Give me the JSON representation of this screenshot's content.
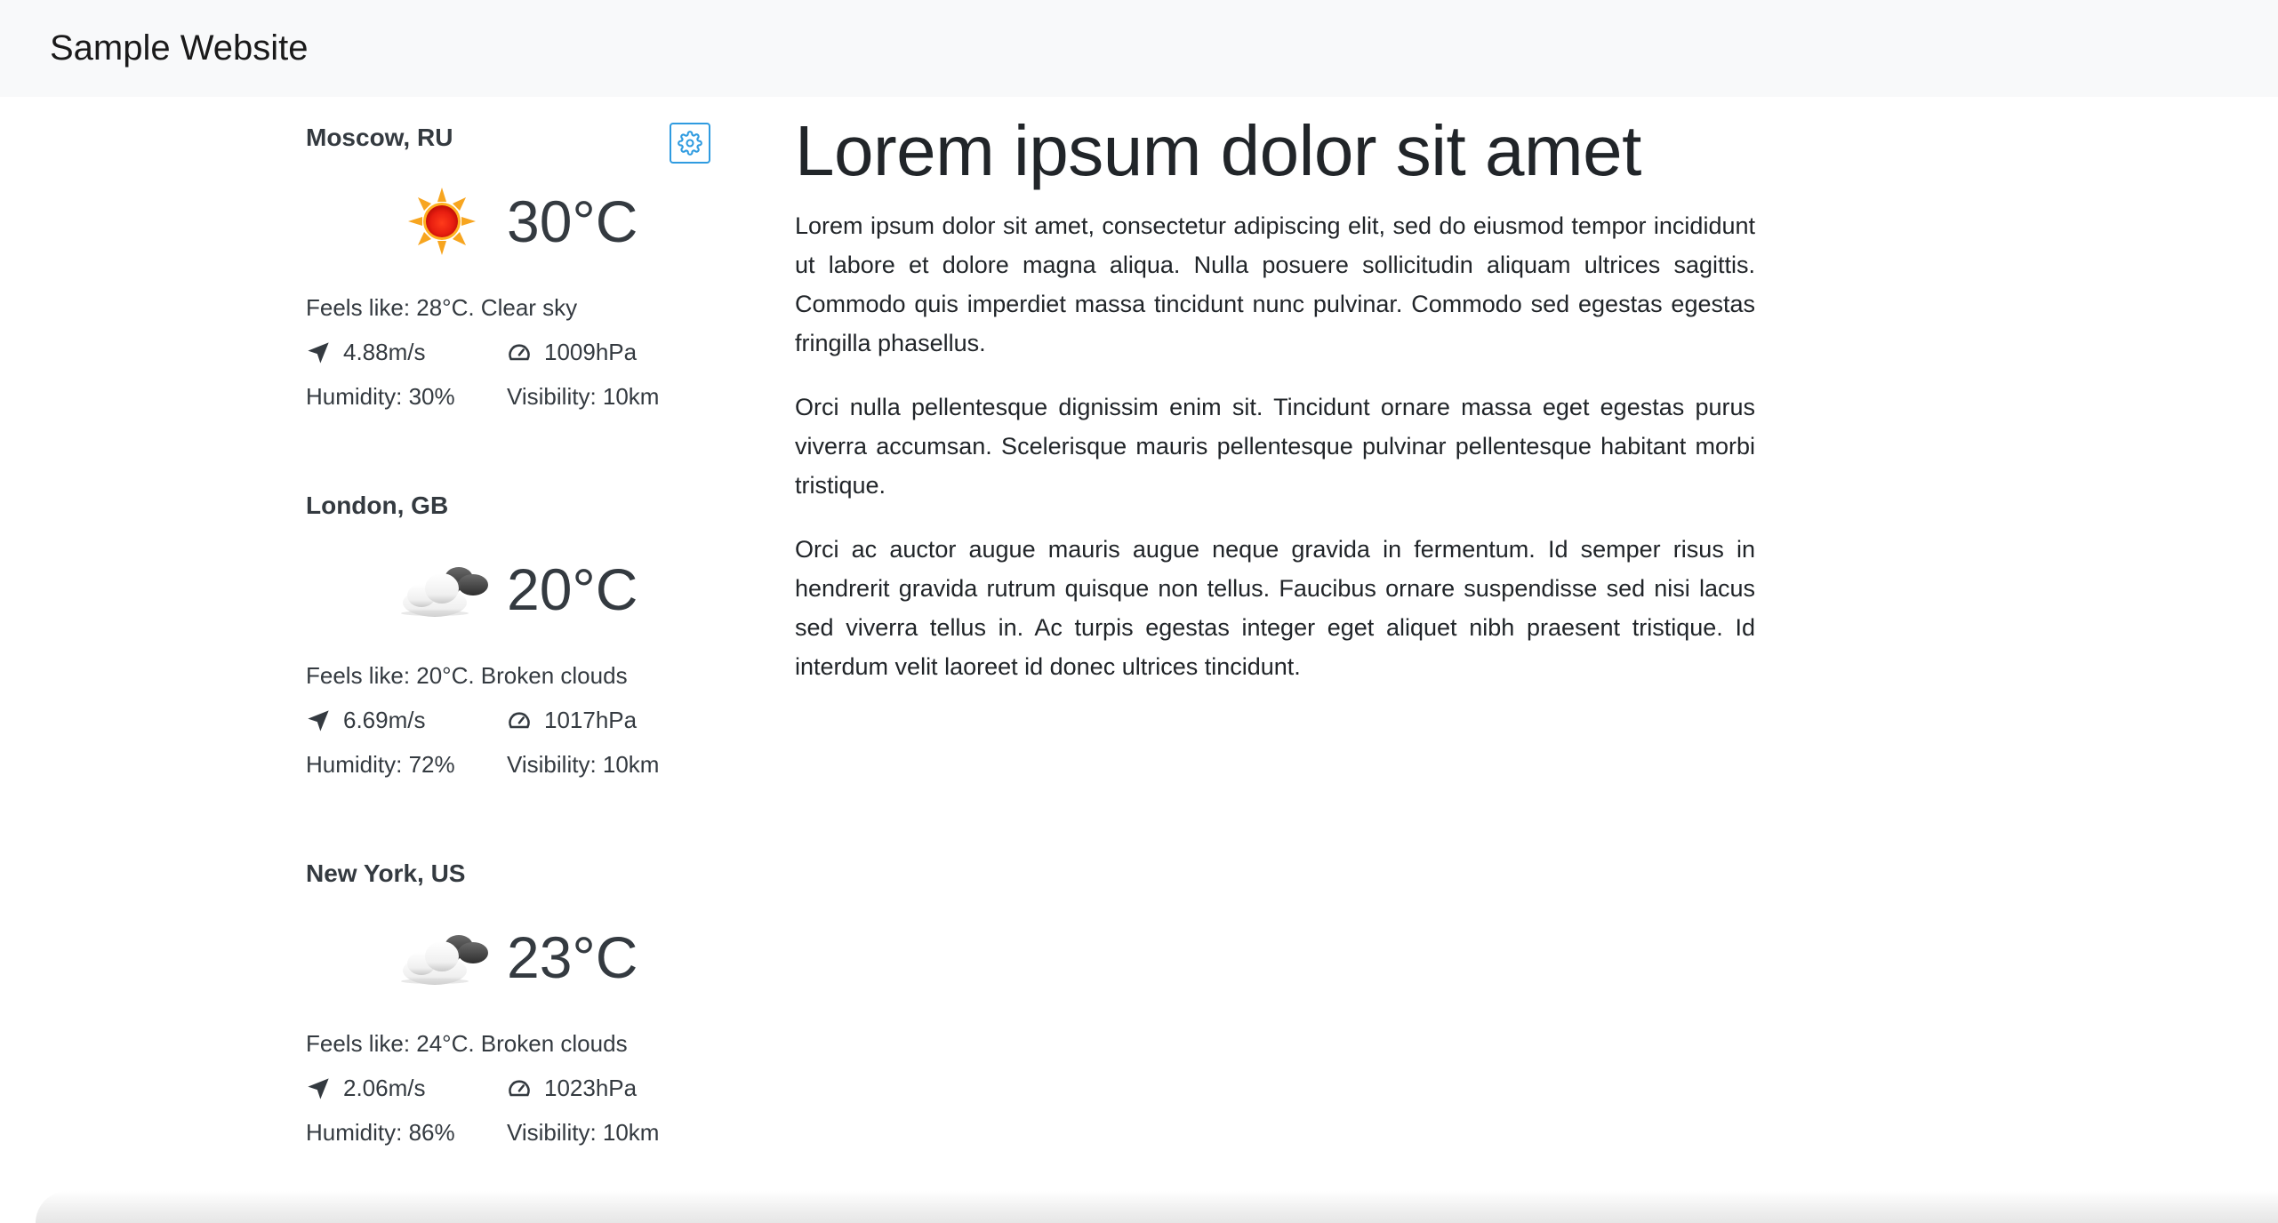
{
  "navbar": {
    "brand": "Sample Website"
  },
  "weather": {
    "settings_icon": "gear-icon",
    "accent_color": "#2f9be0",
    "cities": [
      {
        "name": "Moscow, RU",
        "icon": "sun-icon",
        "temp": "30°C",
        "feels": "Feels like: 28°C. Clear sky",
        "wind": "4.88m/s",
        "pressure": "1009hPa",
        "humidity": "Humidity: 30%",
        "visibility": "Visibility: 10km"
      },
      {
        "name": "London, GB",
        "icon": "broken-clouds-icon",
        "temp": "20°C",
        "feels": "Feels like: 20°C. Broken clouds",
        "wind": "6.69m/s",
        "pressure": "1017hPa",
        "humidity": "Humidity: 72%",
        "visibility": "Visibility: 10km"
      },
      {
        "name": "New York, US",
        "icon": "broken-clouds-icon",
        "temp": "23°C",
        "feels": "Feels like: 24°C. Broken clouds",
        "wind": "2.06m/s",
        "pressure": "1023hPa",
        "humidity": "Humidity: 86%",
        "visibility": "Visibility: 10km"
      }
    ]
  },
  "article": {
    "title": "Lorem ipsum dolor sit amet",
    "paragraphs": [
      "Lorem ipsum dolor sit amet, consectetur adipiscing elit, sed do eiusmod tempor incididunt ut labore et dolore magna aliqua. Nulla posuere sollicitudin aliquam ultrices sagittis. Commodo quis imperdiet massa tincidunt nunc pulvinar. Commodo sed egestas egestas fringilla phasellus.",
      "Orci nulla pellentesque dignissim enim sit. Tincidunt ornare massa eget egestas purus viverra accumsan. Scelerisque mauris pellentesque pulvinar pellentesque habitant morbi tristique.",
      "Orci ac auctor augue mauris augue neque gravida in fermentum. Id semper risus in hendrerit gravida rutrum quisque non tellus. Faucibus ornare suspendisse sed nisi lacus sed viverra tellus in. Ac turpis egestas integer eget aliquet nibh praesent tristique. Id interdum velit laoreet id donec ultrices tincidunt."
    ]
  }
}
